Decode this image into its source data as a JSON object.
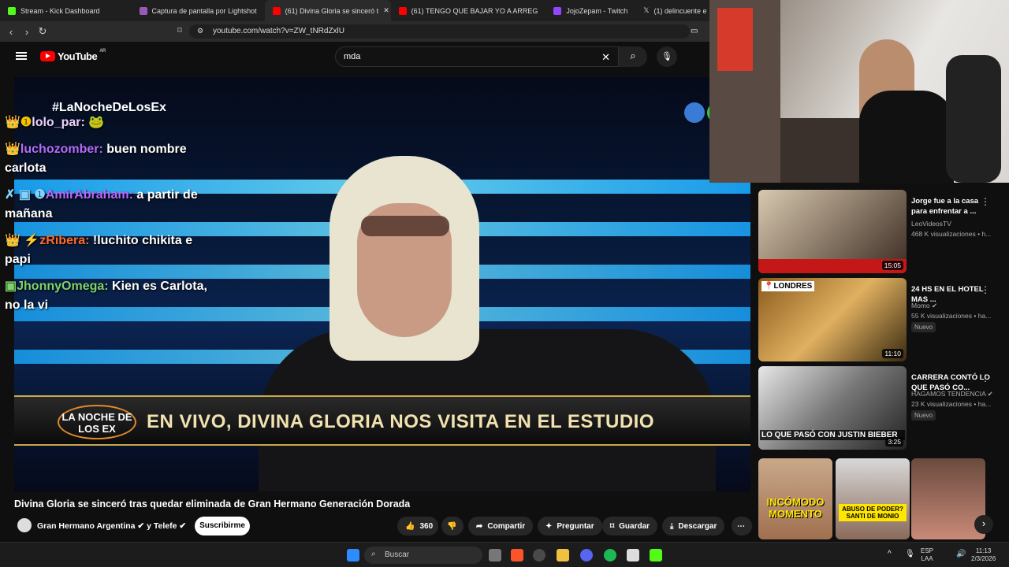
{
  "browser": {
    "tabs": [
      {
        "label": "Stream - Kick Dashboard",
        "color": "#53fc18"
      },
      {
        "label": "Captura de pantalla por Lightshot",
        "color": "#9b59b6"
      },
      {
        "label": "(61) Divina Gloria se sinceró t",
        "color": "#ff0000"
      },
      {
        "label": "(61) TENGO QUE BAJAR YO A ARREG",
        "color": "#ff0000"
      },
      {
        "label": "JojoZepam - Twitch",
        "color": "#9146ff"
      },
      {
        "label": "(1) delincuente e",
        "color": "#ffffff"
      }
    ],
    "url": "youtube.com/watch?v=ZW_tNRdZxlU"
  },
  "youtube": {
    "logo_text": "YouTube",
    "country": "AR",
    "search_value": "mda"
  },
  "video": {
    "hashtag": "#LaNocheDeLosEx",
    "lower_logo": "LA NOCHE DE LOS EX",
    "lower_text": "EN VIVO, DIVINA GLORIA NOS VISITA EN EL ESTUDIO",
    "title": "Divina Gloria se sinceró tras quedar eliminada de Gran Hermano Generación Dorada",
    "channel": "Gran Hermano Argentina ✔ y Telefe ✔",
    "subscribe": "Suscribirme",
    "likes": "360",
    "share": "Compartir",
    "ask": "Preguntar",
    "save": "Guardar",
    "download": "Descargar"
  },
  "chat": [
    {
      "user": "lolo_par:",
      "msg": "🐸",
      "color": "#e8d4ff",
      "badges": "👑❶"
    },
    {
      "user": "luchozomber:",
      "msg": "buen nombre carlota",
      "color": "#b36bff",
      "badges": "👑"
    },
    {
      "user": "AmirAbraham:",
      "msg": "a partir de mañana",
      "color": "#b36bff",
      "badges": "✗ ▣ ❶"
    },
    {
      "user": "zRibera:",
      "msg": "!luchito chikita e papi",
      "color": "#ff6a2a",
      "badges": "👑 ⚡"
    },
    {
      "user": "JhonnyOmega:",
      "msg": "Kien es Carlota, no la vi",
      "color": "#7fd36b",
      "badges": "▣"
    }
  ],
  "recommendations": [
    {
      "title": "Jorge fue a la casa para enfrentar a ...",
      "channel": "LeoVideosTV",
      "meta": "468 K visualizaciones • h...",
      "duration": "15:05",
      "badge": ""
    },
    {
      "title": "24 HS EN EL HOTEL MAS ...",
      "channel": "Momo ✔",
      "meta": "55 K visualizaciones • ha...",
      "duration": "11:10",
      "badge": "Nuevo",
      "thumb_text": "📍LONDRES"
    },
    {
      "title": "CARRERA CONTÓ LO QUE PASÓ CO...",
      "channel": "HAGAMOS TENDENCIA ✔",
      "meta": "23 K visualizaciones • ha...",
      "duration": "3:25",
      "badge": "Nuevo",
      "thumb_text": "LO QUE PASÓ CON JUSTIN BIEBER"
    }
  ],
  "shorts": [
    {
      "text": "INCÓMODO MOMENTO"
    },
    {
      "text": "ABUSO DE PODER? SANTI DE MONIO"
    },
    {
      "text": ""
    }
  ],
  "taskbar": {
    "search": "Buscar",
    "lang": "ESP",
    "lang2": "LAA",
    "time": "11:13",
    "date": "2/3/2026"
  }
}
